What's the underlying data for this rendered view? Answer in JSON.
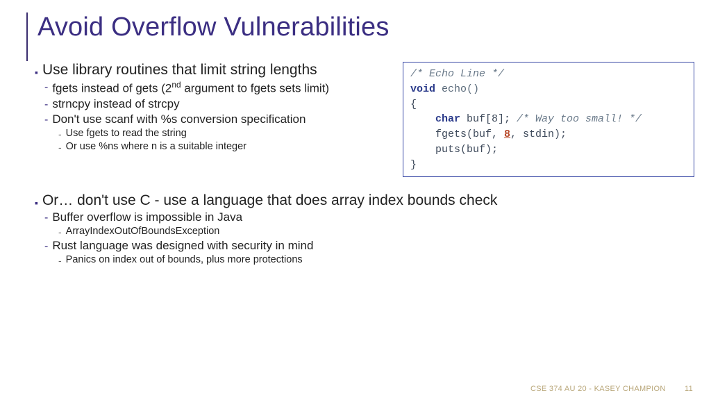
{
  "title": "Avoid Overflow Vulnerabilities",
  "b1": {
    "main": "Use library routines that limit string lengths",
    "s1a_pre": "fgets instead of gets (2",
    "s1a_sup": "nd",
    "s1a_post": " argument to fgets sets limit)",
    "s1b": "strncpy instead of strcpy",
    "s1c": "Don't use scanf with %s conversion specification",
    "s1c_1": "Use fgets to read the string",
    "s1c_2": "Or use %ns where n is a suitable integer"
  },
  "b2": {
    "main": "Or… don't use C - use a language that does array index bounds check",
    "s2a": "Buffer overflow is impossible in Java",
    "s2a_1": "ArrayIndexOutOfBoundsException",
    "s2b": "Rust language was designed with security in mind",
    "s2b_1": "Panics on index out of bounds, plus more protections"
  },
  "code": {
    "c1": "/* Echo Line */",
    "c2_kw": "void",
    "c2_fn": " echo()",
    "c3": "{",
    "c4_kw": "char",
    "c4_rest": " buf[8];  ",
    "c4_cmt": "/* Way too small! */",
    "c5_pre": "fgets(buf, ",
    "c5_hl": "8",
    "c5_post": ", stdin);",
    "c6": "puts(buf);",
    "c7": "}"
  },
  "footer": {
    "text": "CSE 374 AU 20 - KASEY CHAMPION",
    "page": "11"
  }
}
